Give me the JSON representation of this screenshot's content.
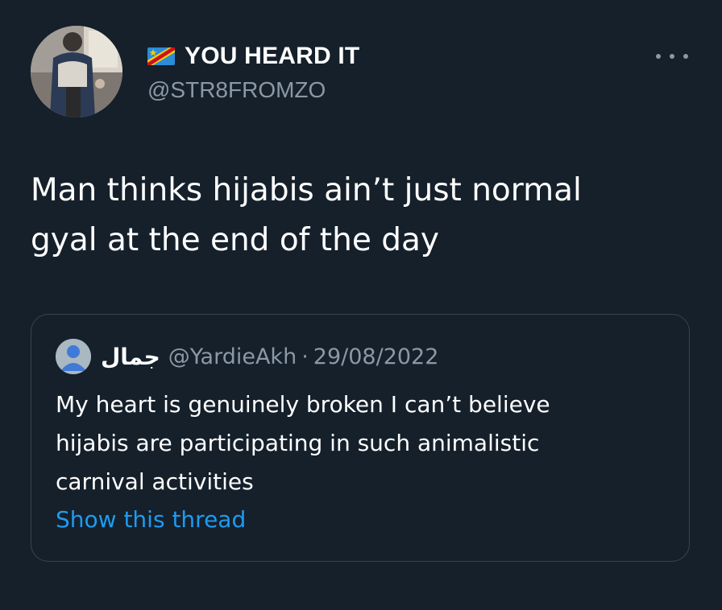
{
  "tweet": {
    "author": {
      "display_name": "YOU HEARD IT",
      "handle": "@STR8FROMZO",
      "flag_icon": "dr-congo-flag-icon",
      "avatar_icon": "profile-photo"
    },
    "more_icon": "more-options-icon",
    "text_lines": [
      "Man thinks hijabis ain’t just normal",
      "gyal at the end of the day"
    ]
  },
  "quoted_tweet": {
    "avatar_icon": "default-avatar-icon",
    "display_name": "جمال",
    "handle": "@YardieAkh",
    "separator": "·",
    "date": "29/08/2022",
    "text_lines": [
      "My heart is genuinely broken I can’t believe",
      "hijabis are participating in such animalistic",
      "carnival activities"
    ],
    "show_thread_label": "Show this thread"
  },
  "colors": {
    "background": "#15202b",
    "primary_text": "#ffffff",
    "secondary_text": "#8b98a5",
    "link": "#1d9bf0",
    "border": "#38444d"
  }
}
